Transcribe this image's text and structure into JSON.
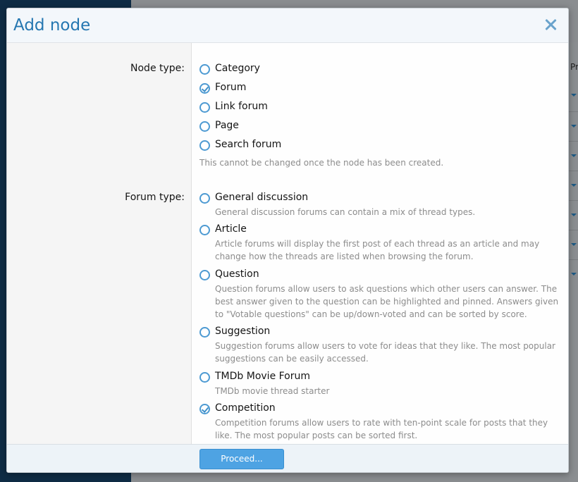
{
  "dialog": {
    "title": "Add node",
    "node_type": {
      "label": "Node type:",
      "options": [
        {
          "label": "Category",
          "checked": false
        },
        {
          "label": "Forum",
          "checked": true
        },
        {
          "label": "Link forum",
          "checked": false
        },
        {
          "label": "Page",
          "checked": false
        },
        {
          "label": "Search forum",
          "checked": false
        }
      ],
      "hint": "This cannot be changed once the node has been created."
    },
    "forum_type": {
      "label": "Forum type:",
      "options": [
        {
          "label": "General discussion",
          "checked": false,
          "description": "General discussion forums can contain a mix of thread types."
        },
        {
          "label": "Article",
          "checked": false,
          "description": "Article forums will display the first post of each thread as an article and may change how the threads are listed when browsing the forum."
        },
        {
          "label": "Question",
          "checked": false,
          "description": "Question forums allow users to ask questions which other users can answer. The best answer given to the question can be highlighted and pinned. Answers given to \"Votable questions\" can be up/down-voted and can be sorted by score."
        },
        {
          "label": "Suggestion",
          "checked": false,
          "description": "Suggestion forums allow users to vote for ideas that they like. The most popular suggestions can be easily accessed."
        },
        {
          "label": "TMDb Movie Forum",
          "checked": false,
          "description": "TMDb movie thread starter"
        },
        {
          "label": "Competition",
          "checked": true,
          "description": "Competition forums allow users to rate with ten-point scale for posts that they like. The most popular posts can be sorted first."
        }
      ]
    },
    "proceed_label": "Proceed...",
    "background_right_header": "Pr"
  },
  "colors": {
    "accent": "#2577b1",
    "button": "#4ea3e3",
    "sidebar": "#0f2c45"
  }
}
